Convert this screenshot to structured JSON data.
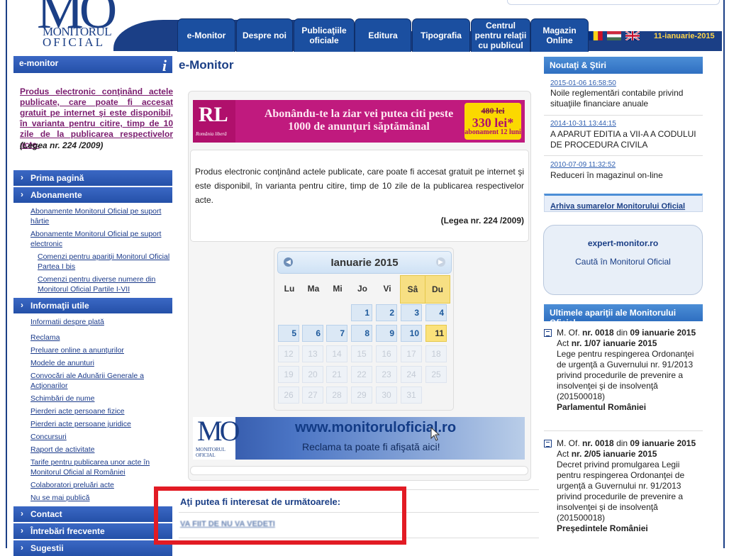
{
  "header": {
    "logo_line1": "MONITORUL",
    "logo_line2": "OFICIAL",
    "nav": [
      "e-Monitor",
      "Despre noi",
      "Publicaţiile oficiale",
      "Editura",
      "Tipografia",
      "Centrul pentru relaţii cu publicul",
      "Magazin Online"
    ],
    "date": "11-ianuarie-2015"
  },
  "sidebar": {
    "title": "e-monitor",
    "lead": "Produs electronic conţinând actele publicate, care poate fi accesat gratuit pe internet şi este disponibil, în varianta pentru citire, timp de 10 zile de la publicarea respectivelor acte.",
    "law": "(Legea nr. 224 /2009)",
    "sections": {
      "prima": "Prima pagină",
      "abonamente": "Abonamente",
      "informatii": "Informaţii utile",
      "contact": "Contact",
      "intrebari": "Întrebări frecvente",
      "sugestii": "Sugestii"
    },
    "abonamente_links": [
      "Abonamente Monitorul Oficial pe suport hârtie",
      "Abonamente Monitorul Oficial pe suport electronic",
      "Comenzi pentru apariţii Monitorul Oficial Partea I bis",
      "Comenzi pentru diverse numere din Monitorul Oficial Partile I-VII"
    ],
    "info_links": [
      "Informatii despre plată",
      "Reclama",
      "Preluare online a anunţurilor",
      "Modele de anunturi",
      "Convocări ale Adunării Generale a Acţionarilor",
      "Schimbări de nume",
      "Pierderi acte persoane fizice",
      "Pierderi acte persoane juridice",
      "Concursuri",
      "Raport de activitate",
      "Tarife pentru publicarea unor acte în Monitorul Oficial al României",
      "Colaboratori preluări acte",
      "Nu se mai publică"
    ]
  },
  "main": {
    "title": "e-Monitor",
    "ad": {
      "logo": "RL",
      "logo_small": "România liberă",
      "text": "Abonându-te la ziar vei putea citi peste 1000 de anunţuri săptămânal",
      "old_price": "480 lei",
      "price": "330 lei*",
      "price_note": "abonament 12 luni"
    },
    "paragraph": "Produs electronic conţinând actele publicate, care poate fi accesat gratuit pe internet şi este disponibil, în varianta pentru citire, timp de 10 zile de la publicarea respectivelor acte.",
    "law": "(Legea nr. 224 /2009)",
    "calendar": {
      "title": "Ianuarie 2015",
      "weekdays": [
        "Lu",
        "Ma",
        "Mi",
        "Jo",
        "Vi",
        "Sâ",
        "Du"
      ],
      "today": 11,
      "active_days_through": 11,
      "days_in_month": 31,
      "first_weekday_index": 3
    },
    "banner": {
      "logo": "MO",
      "logo_sub": "MONITORUL OFICIAL",
      "url": "www.monitoruloficial.ro",
      "sub": "Reclama ta poate fi afişată aici!"
    },
    "interest_title": "Aţi putea fi interesat de următoarele:",
    "interest_link": "VA FIIT DE NU VA VEDETI"
  },
  "right": {
    "news_title": "Noutaţi & Ştiri",
    "news": [
      {
        "date": "2015-01-06 16:58:50",
        "text": "Noile reglementări contabile privind situaţiile financiare anuale"
      },
      {
        "date": "2014-10-31 13:44:15",
        "text": "A APARUT EDITIA a VII-A A CODULUI DE PROCEDURA CIVILA"
      },
      {
        "date": "2010-07-09 11:32:52",
        "text": "Reduceri în magazinul on-line"
      }
    ],
    "arhiva": "Arhiva sumarelor Monitorului Oficial",
    "expert_title": "expert-monitor.ro",
    "expert_sub": "Caută în Monitorul Oficial",
    "ultimele_title": "Ultimele apariţii ale Monitorului Oficial",
    "acts": [
      {
        "l1a": "M. Of.",
        "l1b": "nr. 0018",
        "l1c": "din",
        "l1d": "09 ianuarie 2015",
        "l2a": "Act",
        "l2b": "nr. 1/07 ianuarie 2015",
        "text": "Lege pentru respingerea Ordonanţei de urgenţă a Guvernului nr. 91/2013 privind procedurile de prevenire a insolvenţei şi de insolvenţă (201500018)",
        "issuer": "Parlamentul României"
      },
      {
        "l1a": "M. Of.",
        "l1b": "nr. 0018",
        "l1c": "din",
        "l1d": "09 ianuarie 2015",
        "l2a": "Act",
        "l2b": "nr. 2/05 ianuarie 2015",
        "text": "Decret privind promulgarea Legii pentru respingerea Ordonanţei de urgenţă a Guvernului nr. 91/2013 privind procedurile de prevenire a insolvenţei şi de insolvenţă (201500018)",
        "issuer": "Preşedintele României"
      }
    ]
  },
  "colors": {
    "brand": "#1b3f86",
    "accent": "#e21b24",
    "date": "#ffd54a"
  }
}
